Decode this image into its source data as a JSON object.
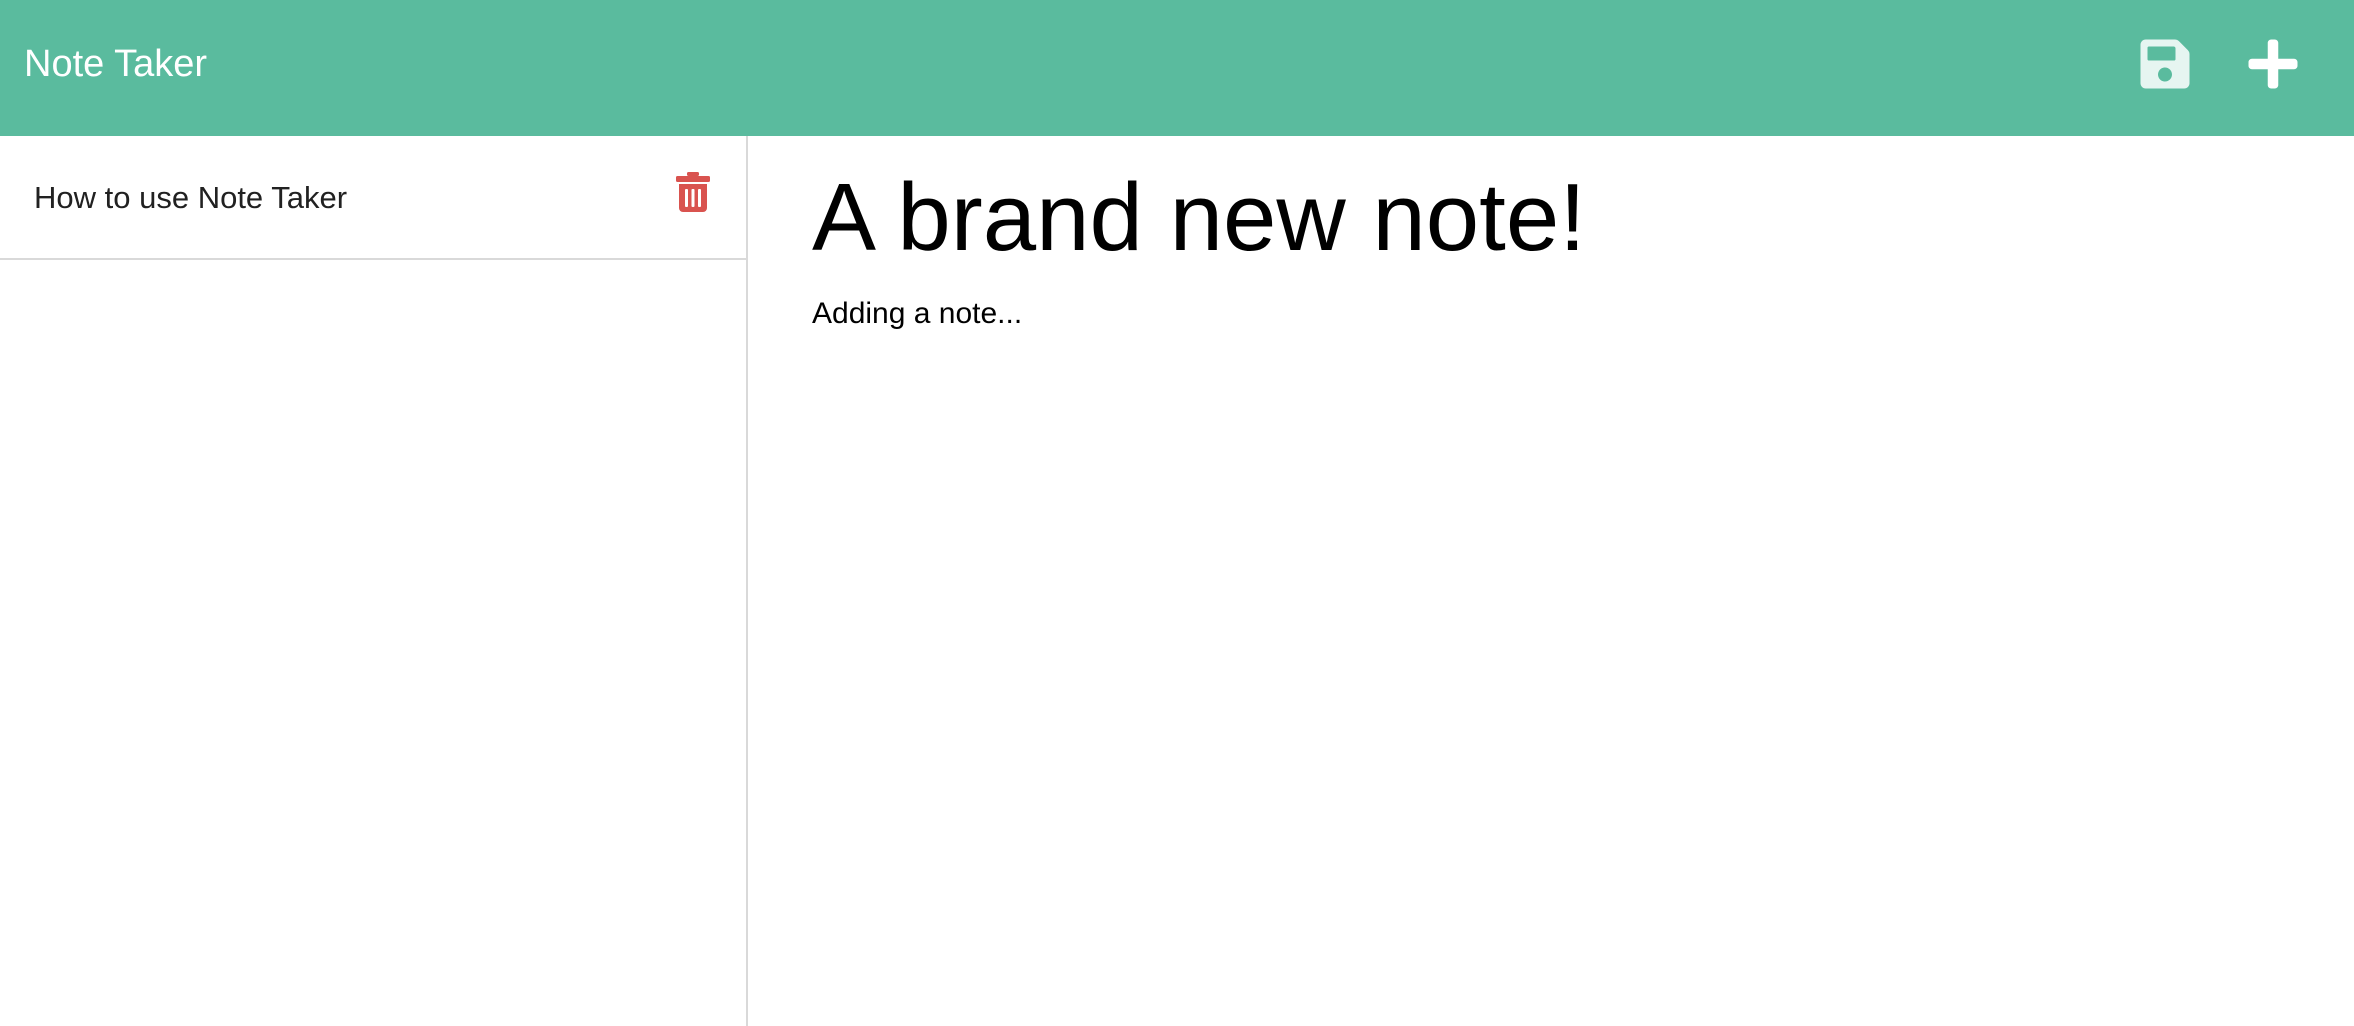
{
  "app": {
    "brand": "Note Taker",
    "accent_color": "#5abb9e",
    "danger_color": "#d9534f"
  },
  "toolbar": {
    "save_icon": "floppy-disk-icon",
    "new_icon": "plus-icon"
  },
  "sidebar": {
    "notes": [
      {
        "title": "How to use Note Taker",
        "icon": "trash-icon"
      }
    ]
  },
  "editor": {
    "title_value": "A brand new note!",
    "body_value": "Adding a note..."
  }
}
